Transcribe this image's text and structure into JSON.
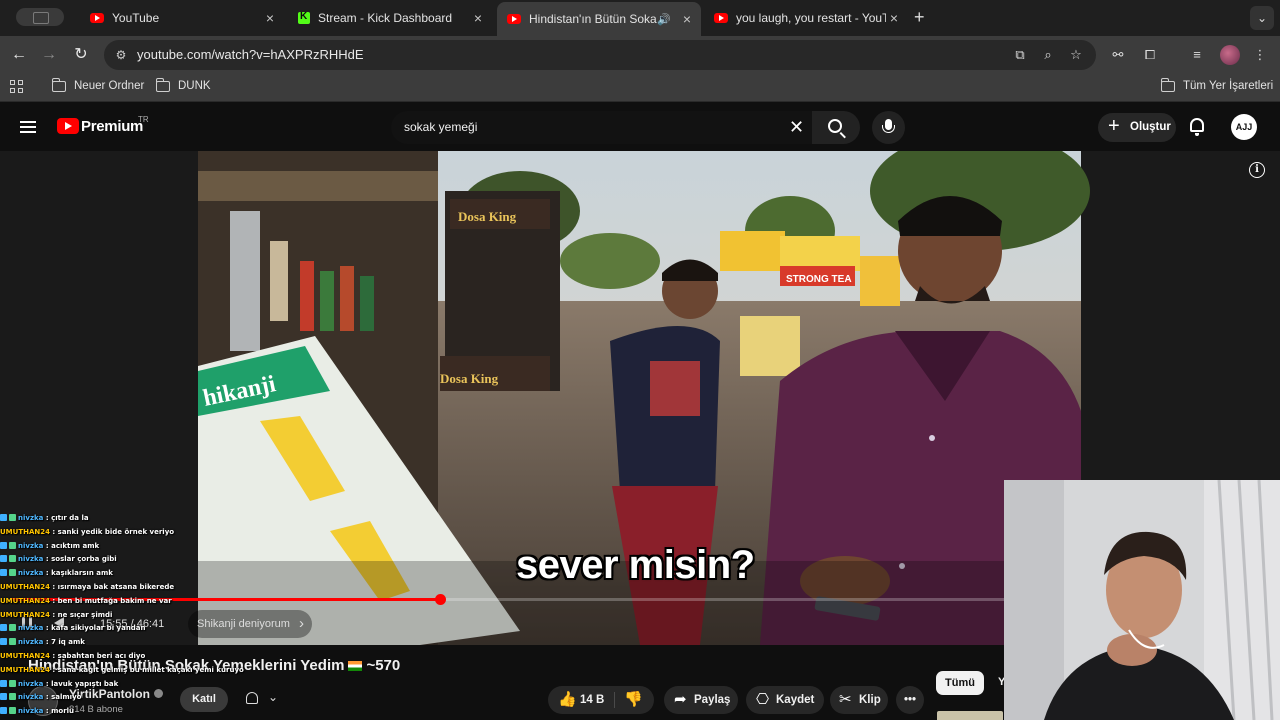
{
  "browser": {
    "tabs": [
      {
        "title": "YouTube",
        "type": "youtube"
      },
      {
        "title": "Stream - Kick Dashboard",
        "type": "kick"
      },
      {
        "title": "Hindistan'ın Bütün Sokak",
        "type": "youtube",
        "active": true,
        "audio": true
      },
      {
        "title": "you laugh, you restart - YouTube",
        "type": "youtube"
      }
    ],
    "url": "youtube.com/watch?v=hAXPRzRHHdE",
    "bookmarks": [
      "Neuer Ordner",
      "DUNK"
    ],
    "all_bookmarks": "Tüm Yer İşaretleri"
  },
  "youtube": {
    "brand": "Premium",
    "country": "TR",
    "search_value": "sokak yemeği",
    "create_label": "Oluştur",
    "avatar_initials": "AJJ"
  },
  "player": {
    "subtitle": "sever misin?",
    "current_time": "15:55",
    "duration": "46:41",
    "time_display": "15:55 / 46:41",
    "progress_fraction": 0.341,
    "chapter": "Shikanji deniyorum"
  },
  "video": {
    "title_main": "Hindistan'ın Bütün Sokak Yemeklerini Yedim",
    "title_suffix": "~570",
    "channel": "YirtikPantolon",
    "subscribers": "814 B abone",
    "join_label": "Katıl",
    "likes": "14 B",
    "share_label": "Paylaş",
    "save_label": "Kaydet",
    "clip_label": "Klip",
    "filter_chip": "Tümü",
    "filter_chip_next": "Y"
  },
  "chat": [
    {
      "user": "nivzka",
      "msg": "çıtır da la",
      "color": "blue",
      "badge": true
    },
    {
      "user": "UMUTHAN24",
      "msg": "sanki yedik bide örnek veriyo",
      "color": "gold",
      "badge": false
    },
    {
      "user": "nivzka",
      "msg": "acıktım amk",
      "color": "blue",
      "badge": true
    },
    {
      "user": "nivzka",
      "msg": "soslar çorba gibi",
      "color": "blue",
      "badge": true
    },
    {
      "user": "nivzka",
      "msg": "kaşıklarsın amk",
      "color": "blue",
      "badge": true
    },
    {
      "user": "UMUTHAN24",
      "msg": "ısırmaya bak atsana bikerede",
      "color": "gold",
      "badge": false
    },
    {
      "user": "UMUTHAN24",
      "msg": "ben bi mutfağa bakim ne var",
      "color": "gold",
      "badge": false
    },
    {
      "user": "UMUTHAN24",
      "msg": "ne sıçar şimdi",
      "color": "gold",
      "badge": false
    },
    {
      "user": "nivzka",
      "msg": "kafa sikiyolar bi yandan",
      "color": "blue",
      "badge": true
    },
    {
      "user": "nivzka",
      "msg": "7 iq amk",
      "color": "blue",
      "badge": true
    },
    {
      "user": "UMUTHAN24",
      "msg": "sabahtan beri acı diyo",
      "color": "gold",
      "badge": false
    },
    {
      "user": "UMUTHAN24",
      "msg": "sana kağıt gelmiş bu millet kaçakı yemi kuruyo",
      "color": "gold",
      "badge": false
    },
    {
      "user": "nivzka",
      "msg": "lavuk yapıştı bak",
      "color": "blue",
      "badge": true
    },
    {
      "user": "nivzka",
      "msg": "salmıyo",
      "color": "blue",
      "badge": true
    },
    {
      "user": "nivzka",
      "msg": "morlu",
      "color": "blue",
      "badge": true
    }
  ],
  "colors": {
    "accent": "#ff0000",
    "kick": "#53fc18",
    "chat_user_blue": "#4fb8ff",
    "chat_user_gold": "#ffc400"
  }
}
